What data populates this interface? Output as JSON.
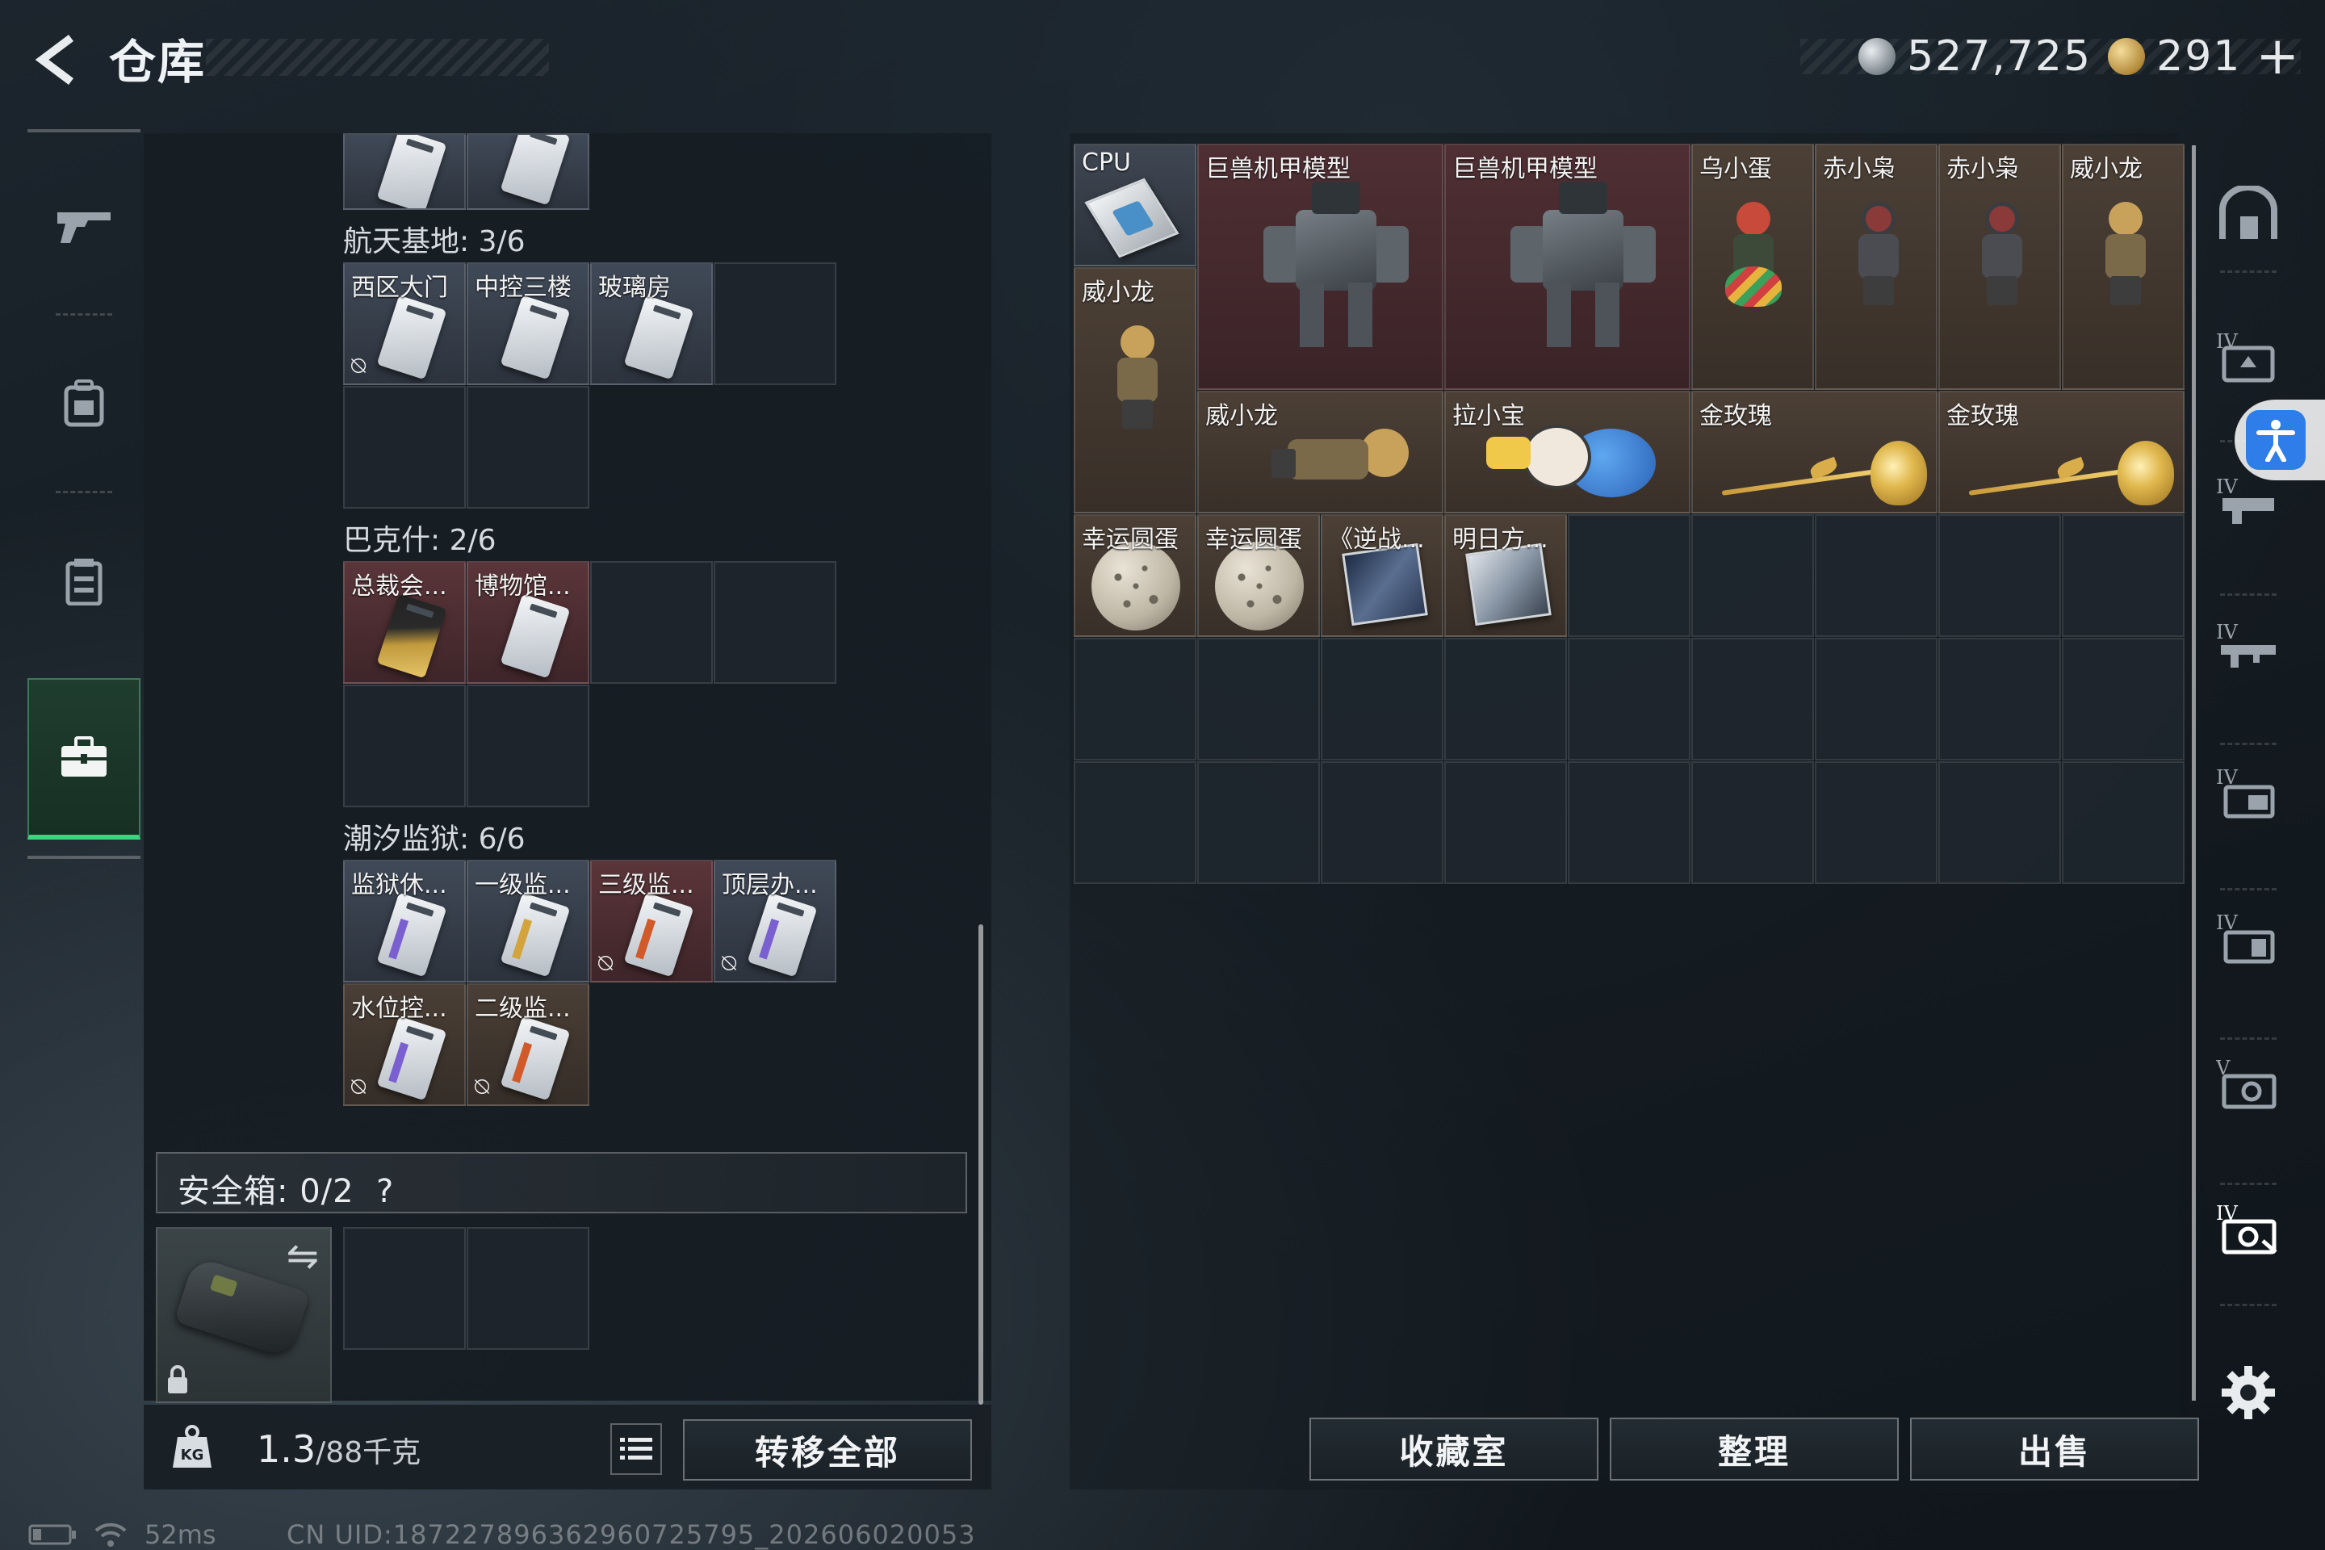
{
  "header": {
    "title": "仓库",
    "currency_silver": "527,725",
    "currency_gold": "291",
    "plus": "+"
  },
  "left_nav": {
    "items": [
      {
        "icon": "gun-icon"
      },
      {
        "icon": "backpack-icon"
      },
      {
        "icon": "vest-icon"
      },
      {
        "icon": "briefcase-icon",
        "active": true
      }
    ]
  },
  "keycards": {
    "top_section": {
      "items": [
        {
          "label": ""
        },
        {
          "label": ""
        }
      ]
    },
    "sections": [
      {
        "label": "航天基地: 3/6",
        "items": [
          {
            "label": "西区大门",
            "no_swap": true
          },
          {
            "label": "中控三楼",
            "no_swap": false
          },
          {
            "label": "玻璃房",
            "no_swap": false
          }
        ]
      },
      {
        "label": "巴克什: 2/6",
        "items": [
          {
            "label": "总裁会...",
            "no_swap": false
          },
          {
            "label": "博物馆...",
            "no_swap": false
          }
        ]
      },
      {
        "label": "潮汐监狱: 6/6",
        "items": [
          {
            "label": "监狱休...",
            "no_swap": false
          },
          {
            "label": "一级监...",
            "no_swap": false
          },
          {
            "label": "三级监...",
            "no_swap": true
          },
          {
            "label": "顶层办...",
            "no_swap": true
          },
          {
            "label": "水位控...",
            "no_swap": true
          },
          {
            "label": "二级监...",
            "no_swap": true
          }
        ]
      }
    ]
  },
  "safe": {
    "label": "安全箱: 0/2",
    "help": "?",
    "swap_icon": "⇋"
  },
  "bottom_left": {
    "weight": "1.3",
    "weight_max": "/88千克",
    "transfer_all": "转移全部"
  },
  "storage_items": [
    {
      "label": "CPU"
    },
    {
      "label": "巨兽机甲模型"
    },
    {
      "label": "巨兽机甲模型"
    },
    {
      "label": "乌小蛋"
    },
    {
      "label": "赤小枭"
    },
    {
      "label": "赤小枭"
    },
    {
      "label": "威小龙"
    },
    {
      "label": "威小龙"
    },
    {
      "label": "威小龙"
    },
    {
      "label": "拉小宝"
    },
    {
      "label": "金玫瑰"
    },
    {
      "label": "金玫瑰"
    },
    {
      "label": "幸运圆蛋"
    },
    {
      "label": "幸运圆蛋"
    },
    {
      "label": "《逆战..."
    },
    {
      "label": "明日方..."
    }
  ],
  "bottom_buttons": {
    "collection": "收藏室",
    "sort": "整理",
    "sell": "出售"
  },
  "right_column": {
    "icons": [
      "home-icon",
      "tier4-weapon-icon",
      "tier4-gun-icon",
      "tier4-rifle-icon",
      "tier4-case-icon",
      "tier4-box-icon",
      "tier5-safe-icon",
      "tier4-safe-icon"
    ],
    "tier_labels": [
      "IV",
      "IV",
      "IV",
      "IV",
      "IV",
      "V",
      "IV"
    ]
  },
  "status": {
    "ping": "52ms",
    "uid": "CN UID:1872278963629607257​95_202606020053"
  },
  "colors": {
    "accent_green": "#3fd37d",
    "accessibility_blue": "#2f7de8"
  }
}
